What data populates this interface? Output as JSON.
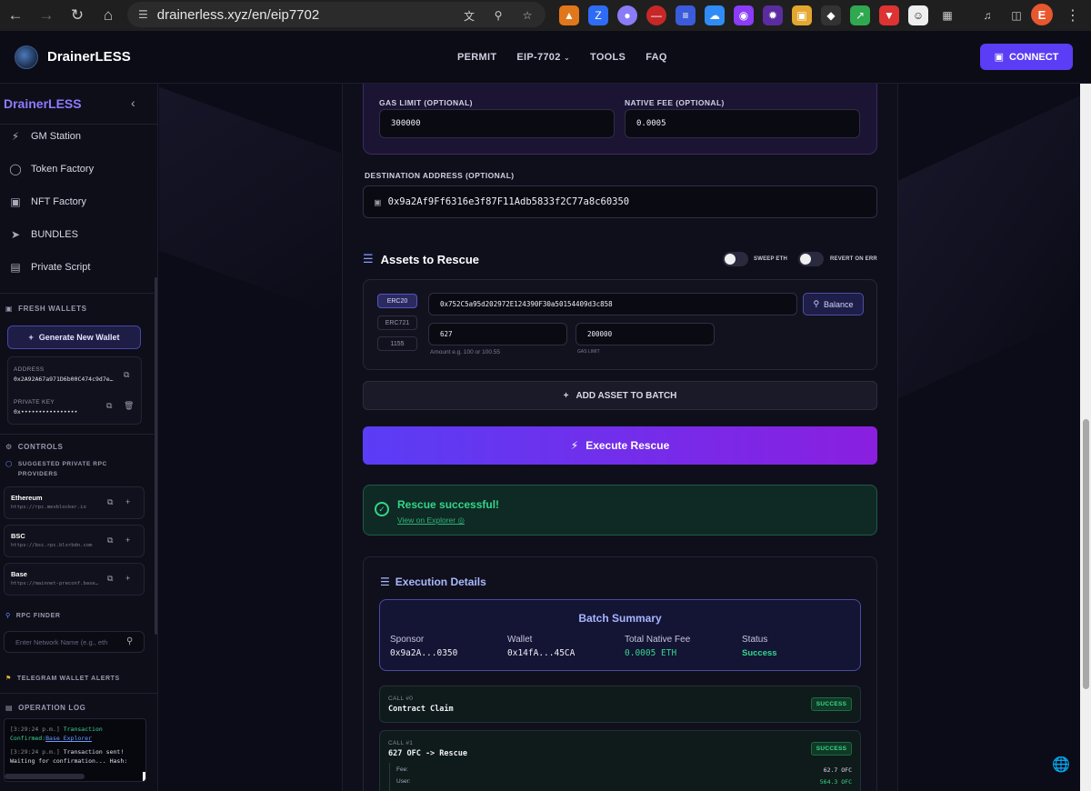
{
  "browser": {
    "url": "drainerless.xyz/en/eip7702",
    "profile_initial": "E"
  },
  "header": {
    "brand": "DrainerLESS",
    "nav": [
      "PERMIT",
      "EIP-7702",
      "TOOLS",
      "FAQ"
    ],
    "connect_label": "CONNECT"
  },
  "sidebar": {
    "brand": "DrainerLESS",
    "items": [
      "GM Station",
      "Token Factory",
      "NFT Factory",
      "BUNDLES",
      "Private Script"
    ],
    "fresh_wallets_title": "FRESH WALLETS",
    "generate_label": "Generate New Wallet",
    "wallet": {
      "address_label": "ADDRESS",
      "address_value": "0x2A92A67a971D6b00C474c9d7e…",
      "private_key_label": "PRIVATE KEY",
      "private_key_value": "0x••••••••••••••••"
    },
    "controls_title": "CONTROLS",
    "rpc_providers_title": "SUGGESTED PRIVATE RPC PROVIDERS",
    "rpc": [
      {
        "name": "Ethereum",
        "url": "https://rpc.mevblocker.io"
      },
      {
        "name": "BSC",
        "url": "https://bsc.rpc.blxrbdn.com"
      },
      {
        "name": "Base",
        "url": "https://mainnet-preconf.base…"
      }
    ],
    "rpc_finder_title": "RPC FINDER",
    "rpc_finder_placeholder": "Enter Network Name (e.g., eth",
    "telegram_title": "TELEGRAM WALLET ALERTS",
    "oplog_title": "OPERATION LOG",
    "log": [
      {
        "time": "[3:29:24 p.m.]",
        "text": "Transaction"
      },
      {
        "time": "",
        "text": "Confirmed:",
        "link": "Base Explorer"
      },
      {
        "time": "[3:29:24 p.m.]",
        "text": "Transaction sent!"
      },
      {
        "time": "",
        "text": "Waiting for confirmation... Hash:"
      }
    ]
  },
  "form": {
    "gas_limit_label": "GAS LIMIT (OPTIONAL)",
    "gas_limit_value": "300000",
    "native_fee_label": "NATIVE FEE (OPTIONAL)",
    "native_fee_value": "0.0005",
    "dest_label": "DESTINATION ADDRESS (OPTIONAL)",
    "dest_value": "0x9a2Af9Ff6316e3f87F11Adb5833f2C77a8c60350"
  },
  "assets": {
    "title": "Assets to Rescue",
    "sweep_label": "SWEEP ETH",
    "revert_label": "REVERT ON ERR",
    "types": [
      "ERC20",
      "ERC721",
      "1155"
    ],
    "token_address": "0x752C5a95d202972E124390F30a50154409d3c858",
    "balance_label": "Balance",
    "amount_value": "627",
    "amount_hint": "Amount e.g. 100 or 100.55",
    "gas_value": "200000",
    "gas_hint": "GAS LIMIT",
    "add_batch_label": "ADD ASSET TO BATCH",
    "execute_label": "Execute Rescue"
  },
  "result": {
    "title": "Rescue successful!",
    "link": "View on Explorer"
  },
  "execution": {
    "title": "Execution Details",
    "summary_title": "Batch Summary",
    "summary": [
      {
        "label": "Sponsor",
        "value": "0x9a2A...0350",
        "color": "#f0f0f8"
      },
      {
        "label": "Wallet",
        "value": "0x14fA...45CA",
        "color": "#f0f0f8"
      },
      {
        "label": "Total Native Fee",
        "value": "0.0005 ETH",
        "color": "#34d58a"
      },
      {
        "label": "Status",
        "value": "Success",
        "color": "#34d58a"
      }
    ],
    "calls": [
      {
        "num": "CALL #0",
        "name": "Contract Claim",
        "status": "SUCCESS"
      },
      {
        "num": "CALL #1",
        "name": "627 OFC -> Rescue",
        "status": "SUCCESS",
        "fee_label": "Fee:",
        "fee_value": "62.7 OFC",
        "user_label": "User:",
        "user_value": "564.3 OFC"
      }
    ]
  }
}
